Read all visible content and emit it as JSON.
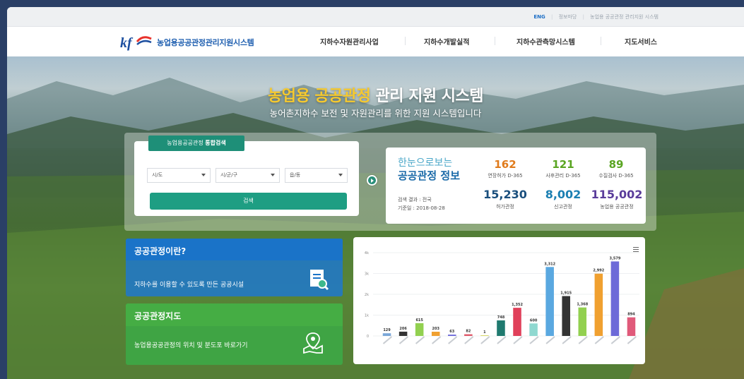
{
  "util": {
    "eng": "ENG",
    "info": "정보마당",
    "site": "농업용 공공관정 관리지원 시스템"
  },
  "nav": {
    "logo_text": "농업용공공관정관리지원시스템",
    "menu": [
      "지하수자원관리사업",
      "지하수개발실적",
      "지하수관측망시스템",
      "지도서비스"
    ]
  },
  "hero": {
    "title_highlight": "농업용 공공관정",
    "title_rest": " 관리 지원 시스템",
    "subtitle": "농어촌지하수 보전 및 자원관리를 위한 지원 시스템입니다"
  },
  "search": {
    "tab_prefix": "농업용공공관정 ",
    "tab_bold": "통합검색",
    "selects": [
      "시/도",
      "시/군/구",
      "읍/동"
    ],
    "button": "검색"
  },
  "stats": {
    "heading1": "한눈으로보는",
    "heading2": "공공관정 정보",
    "result_label": "검색 결과 : 전국",
    "date_label": "기준일 : 2018-08-28",
    "items": [
      {
        "value": "162",
        "label": "연장허가 D-365",
        "color": "#e07b1c"
      },
      {
        "value": "121",
        "label": "사후관리 D-365",
        "color": "#5aa522"
      },
      {
        "value": "89",
        "label": "수질검사 D-365",
        "color": "#5aa522"
      },
      {
        "value": "15,230",
        "label": "허가관정",
        "color": "#1a4f7d"
      },
      {
        "value": "8,002",
        "label": "신고관정",
        "color": "#1b7fb2"
      },
      {
        "value": "115,002",
        "label": "농업용 공공관정",
        "color": "#5a3c9a"
      }
    ]
  },
  "cards": {
    "blue_title": "공공관정이란?",
    "blue_desc": "지하수를 이용할 수 있도록 만든 공공시설",
    "green_title": "공공관정지도",
    "green_desc": "농업용공공관정의 위치 및 분도포 바로가기"
  },
  "chart_data": {
    "type": "bar",
    "y_ticks": [
      "0",
      "1k",
      "2k",
      "3k",
      "4k"
    ],
    "ylim": [
      0,
      4000
    ],
    "values": [
      129,
      206,
      615,
      203,
      63,
      82,
      1,
      748,
      1352,
      600,
      3312,
      1915,
      1368,
      2992,
      3579,
      894
    ],
    "value_labels": [
      "129",
      "206",
      "615",
      "203",
      "63",
      "82",
      "1",
      "748",
      "1,352",
      "600",
      "3,312",
      "1,915",
      "1,368",
      "2,992",
      "3,579",
      "894"
    ],
    "colors": [
      "#7aa7d8",
      "#333333",
      "#92d050",
      "#f0a030",
      "#6d6ad8",
      "#e05a6a",
      "#d8d86a",
      "#1f7a6f",
      "#e0405a",
      "#8fd8d0",
      "#5aa8e0",
      "#333333",
      "#92d050",
      "#f0a030",
      "#6d6ad8",
      "#e05a7a"
    ]
  }
}
